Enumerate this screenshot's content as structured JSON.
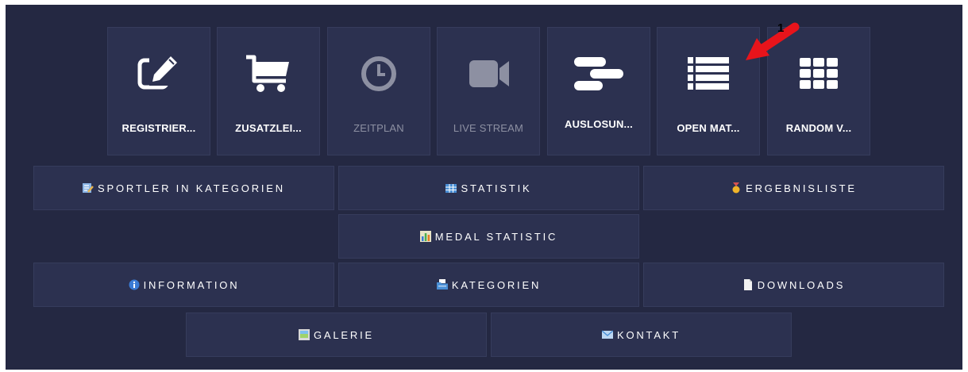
{
  "tiles": [
    {
      "label": "REGISTRIER...",
      "icon": "edit-icon",
      "enabled": true
    },
    {
      "label": "ZUSATZLEI...",
      "icon": "cart-icon",
      "enabled": true
    },
    {
      "label": "ZEITPLAN",
      "icon": "clock-icon",
      "enabled": false
    },
    {
      "label": "LIVE STREAM",
      "icon": "video-camera-icon",
      "enabled": false
    },
    {
      "label": "AUSLOSUN...",
      "icon": "bracket-icon",
      "enabled": true
    },
    {
      "label": "OPEN MAT...",
      "icon": "list-icon",
      "enabled": true
    },
    {
      "label": "RANDOM V...",
      "icon": "grid-icon",
      "enabled": true
    }
  ],
  "buttons": {
    "sportler": "SPORTLER IN KATEGORIEN",
    "statistik": "STATISTIK",
    "ergebnisliste": "ERGEBNISLISTE",
    "medal": "MEDAL STATISTIC",
    "information": "INFORMATION",
    "kategorien": "KATEGORIEN",
    "downloads": "DOWNLOADS",
    "galerie": "GALERIE",
    "kontakt": "KONTAKT"
  },
  "annotation": {
    "number": "1",
    "color": "#e8141b"
  },
  "colors": {
    "background": "#242842",
    "tile": "#2c3150",
    "disabled_text": "#8d90a2"
  }
}
